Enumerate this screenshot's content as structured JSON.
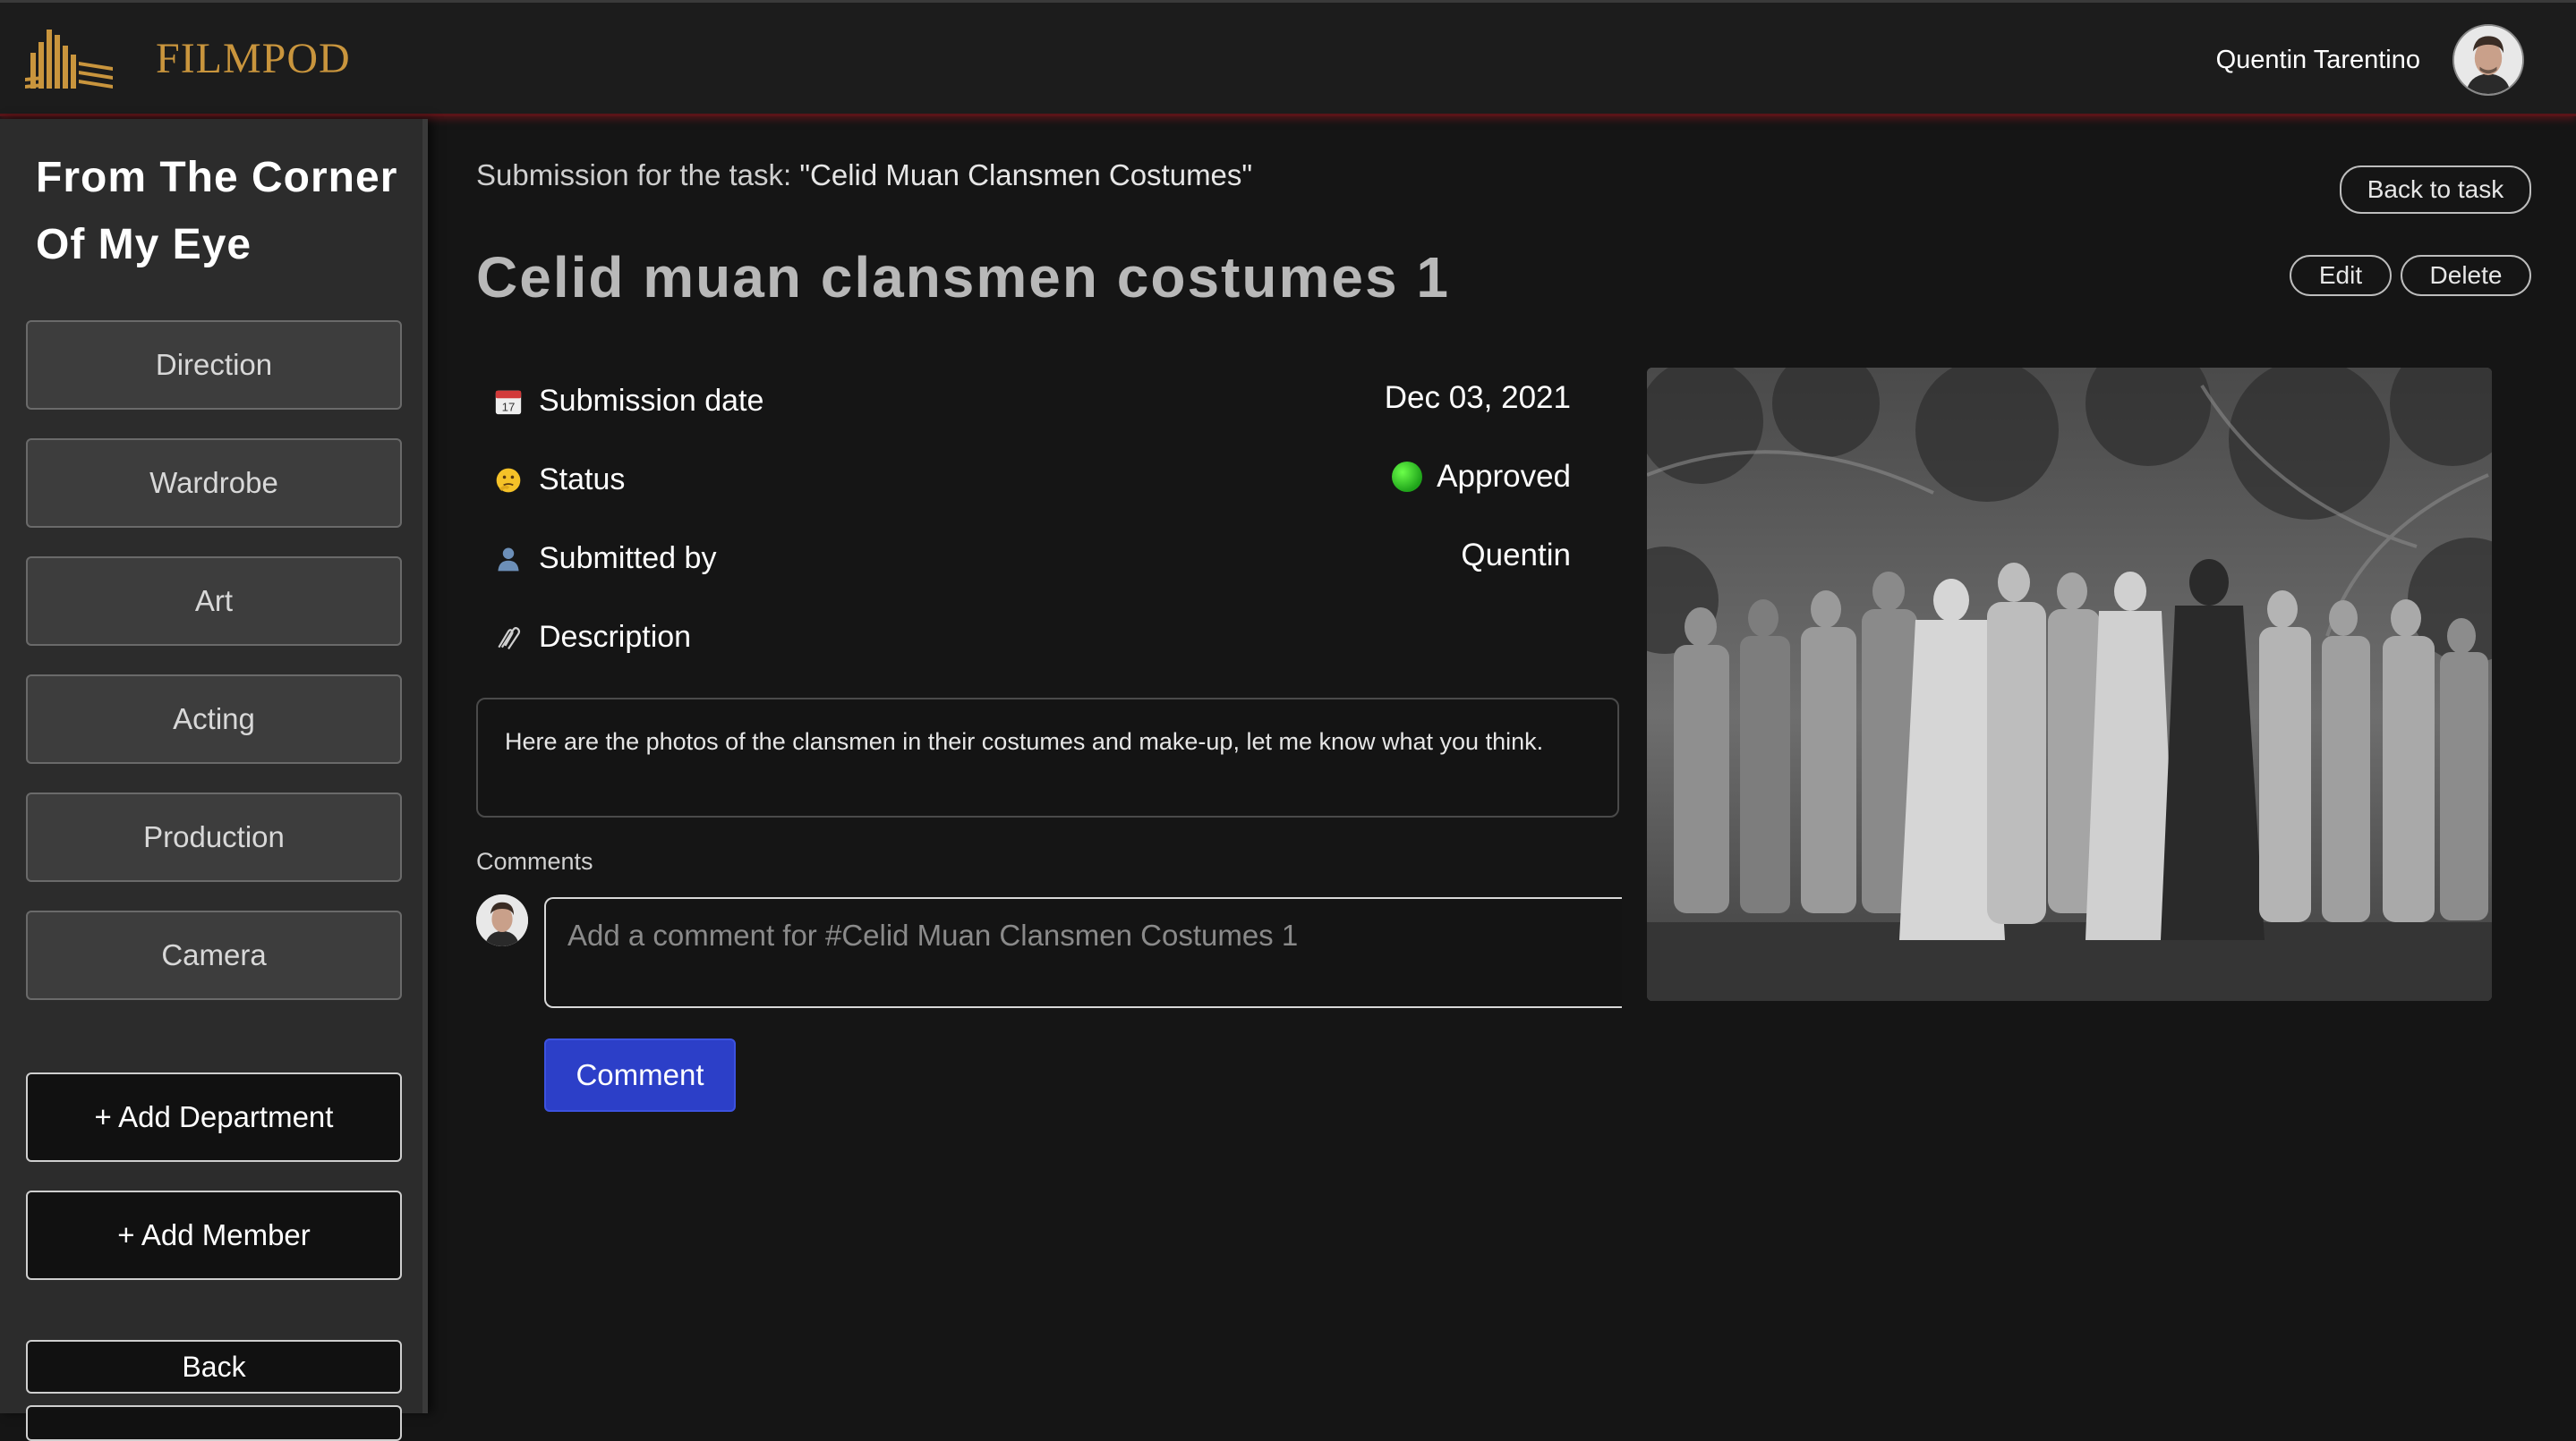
{
  "header": {
    "brand_name": "FILMPOD",
    "user_name": "Quentin Tarentino",
    "logo_icon": "city-skyline-logo-icon",
    "brand_color": "#c9953d"
  },
  "sidebar": {
    "project_title": "From The Corner Of My Eye",
    "departments": [
      {
        "label": "Direction"
      },
      {
        "label": "Wardrobe"
      },
      {
        "label": "Art"
      },
      {
        "label": "Acting"
      },
      {
        "label": "Production"
      },
      {
        "label": "Camera"
      }
    ],
    "add_department_label": "+ Add Department",
    "add_member_label": "+ Add Member",
    "back_label": "Back"
  },
  "submission": {
    "task_prefix": "Submission for the task: ",
    "task_name": "\"Celid Muan Clansmen Costumes\"",
    "back_to_task_label": "Back to task",
    "edit_label": "Edit",
    "delete_label": "Delete",
    "title": "Celid muan clansmen costumes 1",
    "fields": {
      "date_label": "Submission date",
      "date_value": "Dec 03, 2021",
      "date_icon": "calendar-icon",
      "status_label": "Status",
      "status_value": "Approved",
      "status_icon": "thinking-face-icon",
      "status_color": "#1fa31a",
      "submitted_by_label": "Submitted by",
      "submitted_by_value": "Quentin",
      "submitted_by_icon": "person-icon",
      "description_label": "Description",
      "description_icon": "paperclip-icon"
    },
    "description_text": "Here are the photos of the clansmen in their costumes and make-up, let me know what you think.",
    "comments_label": "Comments",
    "comment_placeholder": "Add a comment for #Celid Muan Clansmen Costumes 1",
    "comment_button_label": "Comment",
    "comment_button_color": "#2c3fc8"
  }
}
